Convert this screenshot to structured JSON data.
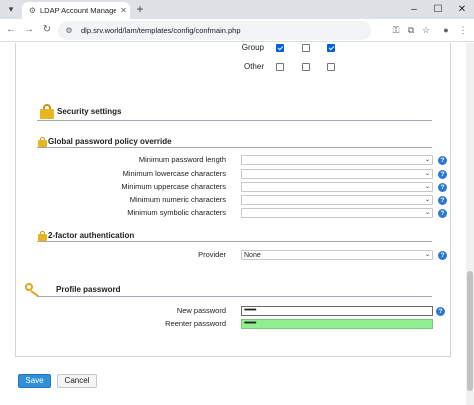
{
  "browser": {
    "tab_title": "LDAP Account Manager Confi",
    "url": "dlp.srv.world/lam/templates/config/confmain.php",
    "new_tab": "+",
    "window_controls": {
      "minimize": "–",
      "maximize": "☐",
      "close": "✕"
    },
    "nav": {
      "back": "←",
      "forward": "→",
      "reload": "↻"
    }
  },
  "permissions": {
    "rows": [
      {
        "label": "Group",
        "checks": [
          true,
          false,
          true
        ]
      },
      {
        "label": "Other",
        "checks": [
          false,
          false,
          false
        ]
      }
    ]
  },
  "security": {
    "title": "Security settings",
    "policy_title": "Global password policy override",
    "policy_rows": [
      {
        "label": "Minimum password length",
        "value": ""
      },
      {
        "label": "Minimum lowercase characters",
        "value": ""
      },
      {
        "label": "Minimum uppercase characters",
        "value": ""
      },
      {
        "label": "Minimum numeric characters",
        "value": ""
      },
      {
        "label": "Minimum symbolic characters",
        "value": ""
      }
    ],
    "twofa_title": "2-factor authentication",
    "provider_label": "Provider",
    "provider_value": "None"
  },
  "profile_password": {
    "title": "Profile password",
    "new_label": "New password",
    "new_value": "••••••••",
    "reenter_label": "Reenter password",
    "reenter_value": "••••••••"
  },
  "buttons": {
    "save": "Save",
    "cancel": "Cancel"
  },
  "help_glyph": "?",
  "colors": {
    "accent": "#2f8fd8",
    "match_green": "#90ee90",
    "lock": "#e8b420",
    "help": "#2a78d2"
  }
}
